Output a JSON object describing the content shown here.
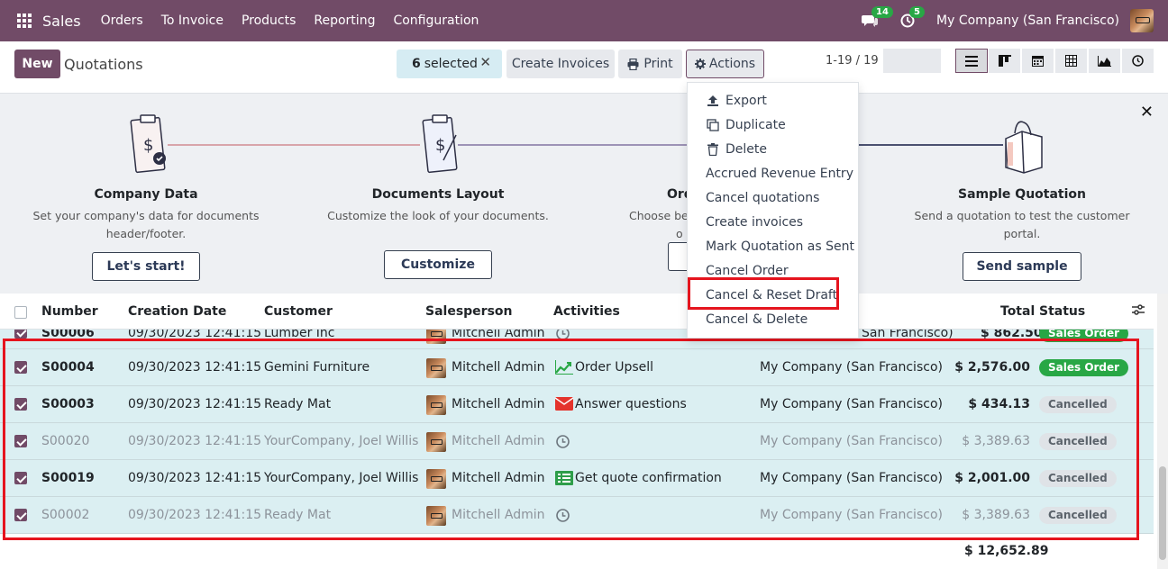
{
  "navbar": {
    "brand": "Sales",
    "menu": [
      "Orders",
      "To Invoice",
      "Products",
      "Reporting",
      "Configuration"
    ],
    "chat_count": "14",
    "activity_count": "5",
    "company": "My Company (San Francisco)"
  },
  "control": {
    "new_label": "New",
    "title": "Quotations",
    "selected_count": "6",
    "selected_label": "selected",
    "create_invoices": "Create Invoices",
    "print": "Print",
    "actions": "Actions",
    "pager": "1-19 / 19"
  },
  "actions_menu": [
    {
      "label": "Export",
      "icon": "upload-icon"
    },
    {
      "label": "Duplicate",
      "icon": "copy-icon"
    },
    {
      "label": "Delete",
      "icon": "trash-icon"
    },
    {
      "label": "Accrued Revenue Entry",
      "icon": ""
    },
    {
      "label": "Cancel quotations",
      "icon": ""
    },
    {
      "label": "Create invoices",
      "icon": ""
    },
    {
      "label": "Mark Quotation as Sent",
      "icon": ""
    },
    {
      "label": "Cancel Order",
      "icon": ""
    },
    {
      "label": "Cancel & Reset Draft",
      "icon": ""
    },
    {
      "label": "Cancel & Delete",
      "icon": ""
    }
  ],
  "banner": {
    "steps": [
      {
        "title": "Company Data",
        "desc1": "Set your company's data for documents",
        "desc2": "header/footer.",
        "button": "Let's start!"
      },
      {
        "title": "Documents Layout",
        "desc1": "Customize the look of your documents.",
        "desc2": "",
        "button": "Customize"
      },
      {
        "title": "Ord",
        "desc1": "Choose bet",
        "desc2": "o",
        "button": ""
      },
      {
        "title": "Sample Quotation",
        "desc1": "Send a quotation to test the customer",
        "desc2": "portal.",
        "button": "Send sample"
      }
    ]
  },
  "table": {
    "headers": {
      "number": "Number",
      "date": "Creation Date",
      "customer": "Customer",
      "salesperson": "Salesperson",
      "activities": "Activities",
      "total": "Total",
      "status": "Status"
    },
    "partial_row": {
      "number": "S00006",
      "date": "09/30/2023 12:41:15",
      "customer": "Lumber Inc",
      "salesperson": "Mitchell Admin",
      "company": "San Francisco)",
      "total": "$ 862.50",
      "status": "Sales Order"
    },
    "rows": [
      {
        "number": "S00004",
        "date": "09/30/2023 12:41:15",
        "customer": "Gemini Furniture",
        "salesperson": "Mitchell Admin",
        "activity": "Order Upsell",
        "activity_icon": "trend-chart-icon",
        "company": "My Company (San Francisco)",
        "total": "$ 2,576.00",
        "status": "Sales Order",
        "muted": false
      },
      {
        "number": "S00003",
        "date": "09/30/2023 12:41:15",
        "customer": "Ready Mat",
        "salesperson": "Mitchell Admin",
        "activity": "Answer questions",
        "activity_icon": "envelope-icon",
        "company": "My Company (San Francisco)",
        "total": "$ 434.13",
        "status": "Cancelled",
        "muted": false
      },
      {
        "number": "S00020",
        "date": "09/30/2023 12:41:15",
        "customer": "YourCompany, Joel Willis",
        "salesperson": "Mitchell Admin",
        "activity": "",
        "activity_icon": "clock-icon",
        "company": "My Company (San Francisco)",
        "total": "$ 3,389.63",
        "status": "Cancelled",
        "muted": true
      },
      {
        "number": "S00019",
        "date": "09/30/2023 12:41:15",
        "customer": "YourCompany, Joel Willis",
        "salesperson": "Mitchell Admin",
        "activity": "Get quote confirmation",
        "activity_icon": "list-icon",
        "company": "My Company (San Francisco)",
        "total": "$ 2,001.00",
        "status": "Cancelled",
        "muted": false
      },
      {
        "number": "S00002",
        "date": "09/30/2023 12:41:15",
        "customer": "Ready Mat",
        "salesperson": "Mitchell Admin",
        "activity": "",
        "activity_icon": "clock-icon",
        "company": "My Company (San Francisco)",
        "total": "$ 3,389.63",
        "status": "Cancelled",
        "muted": true
      }
    ],
    "grand_total": "$ 12,652.89"
  },
  "colors": {
    "brand": "#714b67",
    "highlight": "#e5141e",
    "row_selected": "#dbeff2",
    "sales_order": "#28a745"
  }
}
